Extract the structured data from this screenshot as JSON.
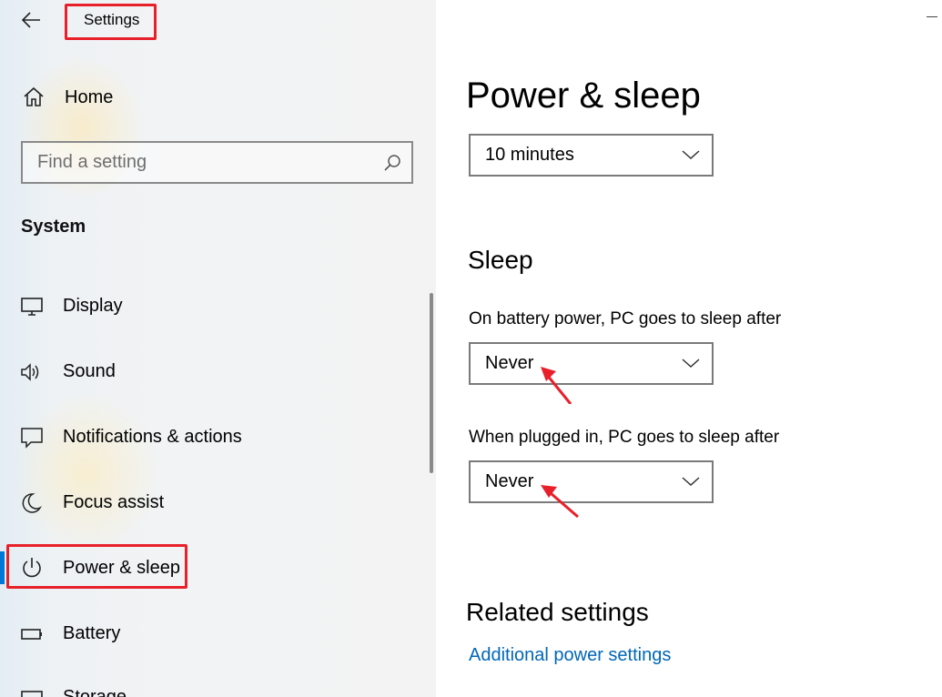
{
  "window": {
    "title": "Settings"
  },
  "sidebar": {
    "home_label": "Home",
    "search_placeholder": "Find a setting",
    "section_heading": "System",
    "items": [
      {
        "label": "Display",
        "icon": "monitor-icon"
      },
      {
        "label": "Sound",
        "icon": "speaker-icon"
      },
      {
        "label": "Notifications & actions",
        "icon": "message-icon"
      },
      {
        "label": "Focus assist",
        "icon": "moon-icon"
      },
      {
        "label": "Power & sleep",
        "icon": "power-icon",
        "active": true
      },
      {
        "label": "Battery",
        "icon": "battery-icon"
      },
      {
        "label": "Storage",
        "icon": "storage-icon"
      }
    ]
  },
  "main": {
    "title": "Power & sleep",
    "screen_timeout_value": "10 minutes",
    "sleep_heading": "Sleep",
    "battery_label": "On battery power, PC goes to sleep after",
    "battery_value": "Never",
    "plugged_label": "When plugged in, PC goes to sleep after",
    "plugged_value": "Never",
    "related_heading": "Related settings",
    "additional_link": "Additional power settings"
  },
  "colors": {
    "accent": "#0078d7",
    "link": "#0067b8",
    "annotation_red": "#e8202a"
  }
}
